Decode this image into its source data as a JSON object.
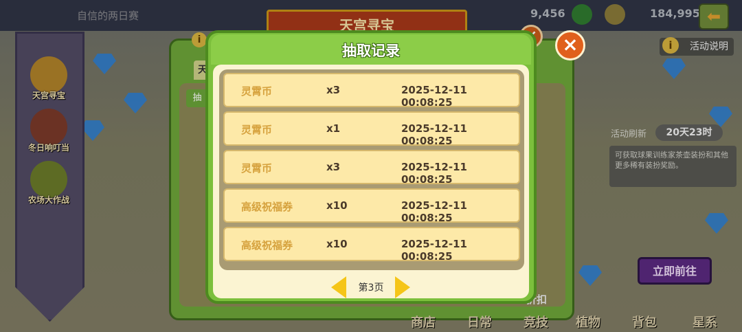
{
  "topbar": {
    "title": "自信的两日赛",
    "gold": "9,456",
    "coins": "184,995",
    "back_icon": "back-arrow-icon"
  },
  "sidebar": {
    "items": [
      {
        "label": "天宫寻宝"
      },
      {
        "label": "冬日响叮当"
      },
      {
        "label": "农场大作战"
      }
    ]
  },
  "background_panel": {
    "title": "天宫寻宝",
    "tab_partial": "天",
    "button_partial": "抽",
    "discount_partial": "折扣"
  },
  "right_panel": {
    "info_label": "活动说明",
    "refresh_label": "活动刷新",
    "refresh_value": "20天23时",
    "description": "可获取球果训练家茶壶装扮和其他更多稀有装扮奖励。",
    "go_button": "立即前往"
  },
  "bottom_nav": [
    "商店",
    "日常",
    "竞技",
    "植物",
    "背包",
    "星系"
  ],
  "modal": {
    "title": "抽取记录",
    "records": [
      {
        "name": "灵霄币",
        "qty": "x3",
        "time": "2025-12-11 00:08:25"
      },
      {
        "name": "灵霄币",
        "qty": "x1",
        "time": "2025-12-11 00:08:25"
      },
      {
        "name": "灵霄币",
        "qty": "x3",
        "time": "2025-12-11 00:08:25"
      },
      {
        "name": "高级祝福券",
        "qty": "x10",
        "time": "2025-12-11 00:08:25"
      },
      {
        "name": "高级祝福券",
        "qty": "x10",
        "time": "2025-12-11 00:08:25"
      }
    ],
    "page_label": "第3页"
  },
  "colors": {
    "modal_green": "#7cbf3c",
    "row_bg": "#fde9a8",
    "item_name": "#d6a23e",
    "arrow_yellow": "#f5c518",
    "close_orange": "#e0601c"
  }
}
